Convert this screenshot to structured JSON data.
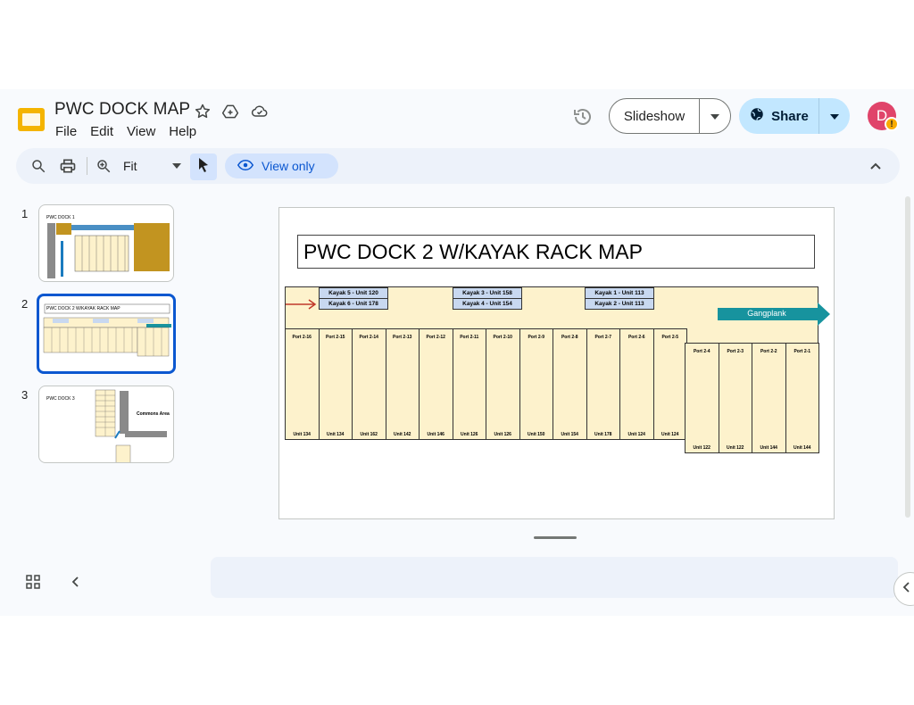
{
  "header": {
    "title": "PWC DOCK MAP",
    "menu": [
      "File",
      "Edit",
      "View",
      "Help"
    ],
    "slideshow_label": "Slideshow",
    "share_label": "Share",
    "avatar_initial": "D",
    "avatar_badge": "!"
  },
  "toolbar": {
    "zoom_label": "Fit",
    "view_only_label": "View only"
  },
  "filmstrip": {
    "slides": [
      {
        "number": "1",
        "title": "PWC DOCK 1"
      },
      {
        "number": "2",
        "title": "PWC DOCK 2 W/KAYAK RACK MAP"
      },
      {
        "number": "3",
        "title": "PWC DOCK 3",
        "label": "Commons Area"
      }
    ]
  },
  "slide": {
    "title": "PWC DOCK 2 W/KAYAK  RACK MAP",
    "kayak_labels": [
      "Kayak 5 -  Unit 120",
      "Kayak 6 - Unit 178",
      "Kayak 3 - Unit 158",
      "Kayak 4 - Unit 154",
      "Kayak 1 - Unit 113",
      "Kayak 2 - Unit 113"
    ],
    "gangplank_label": "Gangplank",
    "ports_upper": [
      {
        "port": "Port 2-16",
        "unit": "Unit 134"
      },
      {
        "port": "Port 2-15",
        "unit": "Unit 134"
      },
      {
        "port": "Port 2-14",
        "unit": "Unit 162"
      },
      {
        "port": "Port 2-13",
        "unit": "Unit 142"
      },
      {
        "port": "Port 2-12",
        "unit": "Unit 146"
      },
      {
        "port": "Port 2-11",
        "unit": "Unit 126"
      },
      {
        "port": "Port 2-10",
        "unit": "Unit 126"
      },
      {
        "port": "Port 2-9",
        "unit": "Unit 150"
      },
      {
        "port": "Port 2-8",
        "unit": "Unit 154"
      },
      {
        "port": "Port 2-7",
        "unit": "Unit 178"
      },
      {
        "port": "Port 2-6",
        "unit": "Unit 124"
      },
      {
        "port": "Port 2-5",
        "unit": "Unit 124"
      }
    ],
    "ports_lower": [
      {
        "port": "Port 2-4",
        "unit": "Unit 122"
      },
      {
        "port": "Port 2-3",
        "unit": "Unit 122"
      },
      {
        "port": "Port 2-2",
        "unit": "Unit 144"
      },
      {
        "port": "Port 2-1",
        "unit": "Unit 144"
      }
    ]
  },
  "colors": {
    "accent": "#0b57d0",
    "share_bg": "#c2e7ff",
    "dock_fill": "#fdf2cc",
    "kayak_fill": "#c8d8f0",
    "gangplank": "#17939e",
    "arrow": "#c0392b",
    "avatar": "#e0446a"
  }
}
